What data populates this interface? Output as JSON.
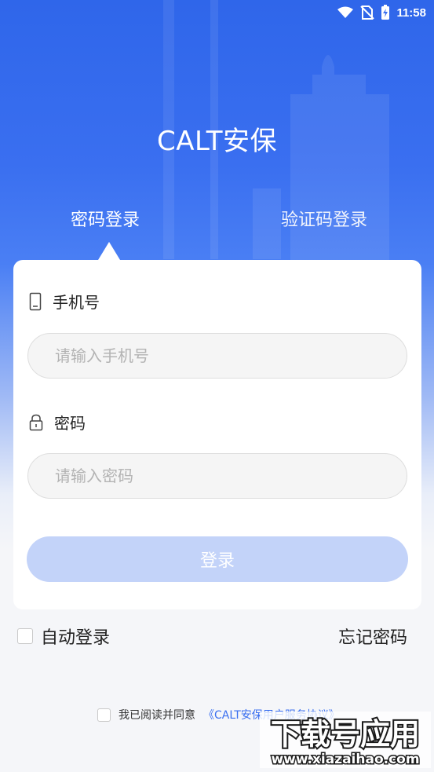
{
  "status_bar": {
    "time": "11:58"
  },
  "app": {
    "title": "CALT安保"
  },
  "tabs": [
    {
      "label": "密码登录",
      "active": true
    },
    {
      "label": "验证码登录",
      "active": false
    }
  ],
  "form": {
    "phone_label": "手机号",
    "phone_placeholder": "请输入手机号",
    "password_label": "密码",
    "password_placeholder": "请输入密码",
    "login_label": "登录"
  },
  "options": {
    "auto_login_label": "自动登录",
    "forgot_password_label": "忘记密码"
  },
  "agreement": {
    "prefix": "我已阅读并同意",
    "link": "《CALT安保用户服务协议》"
  },
  "watermark": {
    "main": "下载号应用",
    "url": "www.xiazaihao.com"
  },
  "colors": {
    "primary": "#3a6ff0",
    "button_disabled": "#c3d3f9",
    "background": "#f5f6f9"
  }
}
